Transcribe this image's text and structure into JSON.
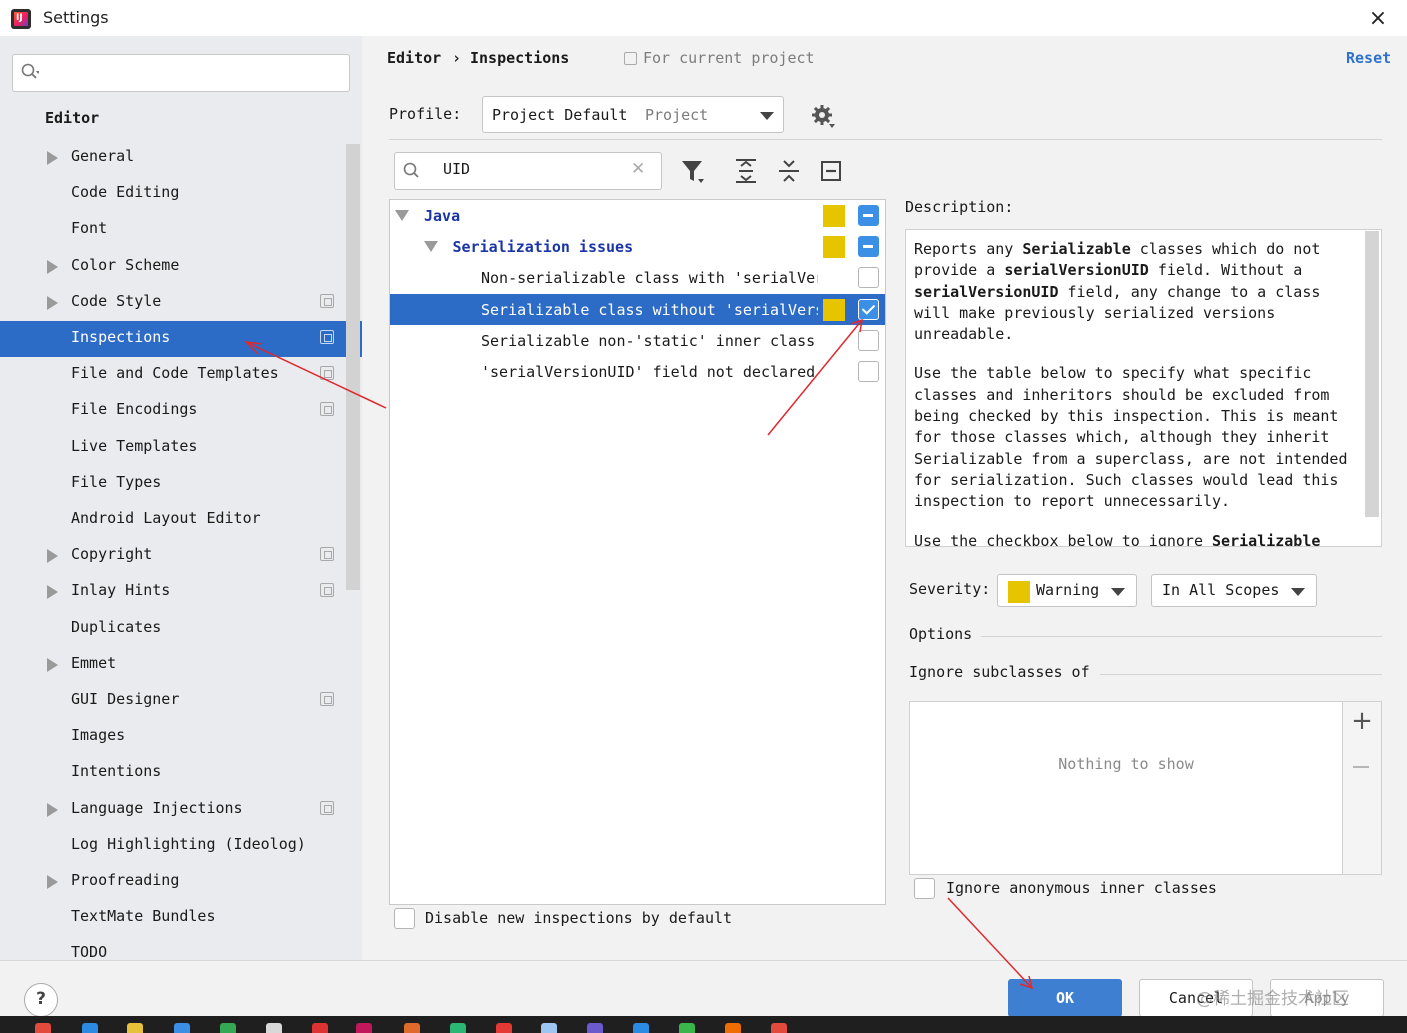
{
  "window": {
    "title": "Settings"
  },
  "sidebar": {
    "search": {
      "value": ""
    },
    "heading": "Editor",
    "items": [
      {
        "label": "General",
        "expandable": true,
        "project_icon": false
      },
      {
        "label": "Code Editing",
        "expandable": false,
        "project_icon": false
      },
      {
        "label": "Font",
        "expandable": false,
        "project_icon": false
      },
      {
        "label": "Color Scheme",
        "expandable": true,
        "project_icon": false
      },
      {
        "label": "Code Style",
        "expandable": true,
        "project_icon": true
      },
      {
        "label": "Inspections",
        "expandable": false,
        "project_icon": true,
        "selected": true
      },
      {
        "label": "File and Code Templates",
        "expandable": false,
        "project_icon": true
      },
      {
        "label": "File Encodings",
        "expandable": false,
        "project_icon": true
      },
      {
        "label": "Live Templates",
        "expandable": false,
        "project_icon": false
      },
      {
        "label": "File Types",
        "expandable": false,
        "project_icon": false
      },
      {
        "label": "Android Layout Editor",
        "expandable": false,
        "project_icon": false
      },
      {
        "label": "Copyright",
        "expandable": true,
        "project_icon": true
      },
      {
        "label": "Inlay Hints",
        "expandable": true,
        "project_icon": true
      },
      {
        "label": "Duplicates",
        "expandable": false,
        "project_icon": false
      },
      {
        "label": "Emmet",
        "expandable": true,
        "project_icon": false
      },
      {
        "label": "GUI Designer",
        "expandable": false,
        "project_icon": true
      },
      {
        "label": "Images",
        "expandable": false,
        "project_icon": false
      },
      {
        "label": "Intentions",
        "expandable": false,
        "project_icon": false
      },
      {
        "label": "Language Injections",
        "expandable": true,
        "project_icon": true
      },
      {
        "label": "Log Highlighting (Ideolog)",
        "expandable": false,
        "project_icon": false
      },
      {
        "label": "Proofreading",
        "expandable": true,
        "project_icon": false
      },
      {
        "label": "TextMate Bundles",
        "expandable": false,
        "project_icon": false
      },
      {
        "label": "TODO",
        "expandable": false,
        "project_icon": false
      }
    ]
  },
  "breadcrumb": {
    "parent": "Editor",
    "separator": "›",
    "current": "Inspections",
    "scope_note": "For current project"
  },
  "reset_label": "Reset",
  "profile": {
    "label": "Profile:",
    "value": "Project Default",
    "scope": "Project"
  },
  "filter": {
    "value": "UID"
  },
  "inspection_tree": [
    {
      "label": "Java",
      "level": 0,
      "group": true,
      "expanded": true,
      "severity_color": "#e6c400",
      "state": "mixed"
    },
    {
      "label": "Serialization issues",
      "level": 1,
      "group": true,
      "expanded": true,
      "severity_color": "#e6c400",
      "state": "mixed"
    },
    {
      "label": "Non-serializable class with 'serialVer",
      "level": 2,
      "group": false,
      "severity_color": "",
      "state": "unchecked"
    },
    {
      "label": "Serializable class without 'serialVers",
      "level": 2,
      "group": false,
      "severity_color": "#e6c400",
      "state": "checked",
      "selected": true
    },
    {
      "label": "Serializable non-'static' inner class",
      "level": 2,
      "group": false,
      "severity_color": "",
      "state": "unchecked"
    },
    {
      "label": "'serialVersionUID' field not declared",
      "level": 2,
      "group": false,
      "severity_color": "",
      "state": "unchecked"
    }
  ],
  "disable_new": {
    "label": "Disable new inspections by default",
    "checked": false
  },
  "description": {
    "label": "Description:",
    "p1": [
      {
        "t": "Reports any ",
        "b": false
      },
      {
        "t": "Serializable",
        "b": true
      },
      {
        "t": " classes which do not provide a ",
        "b": false
      },
      {
        "t": "serialVersionUID",
        "b": true
      },
      {
        "t": " field. Without a ",
        "b": false
      },
      {
        "t": "serialVersionUID",
        "b": true
      },
      {
        "t": " field, any change to a class will make previously serialized versions unreadable.",
        "b": false
      }
    ],
    "p2": [
      {
        "t": "Use the table below to specify what specific classes and inheritors should be excluded from being checked by this inspection. This is meant for those classes which, although they inherit Serializable from a superclass, are not intended for serialization. Such classes would lead this inspection to report unnecessarily.",
        "b": false
      }
    ],
    "p3": [
      {
        "t": "Use the checkbox below to ignore ",
        "b": false
      },
      {
        "t": "Serializable",
        "b": true
      }
    ]
  },
  "severity": {
    "label": "Severity:",
    "value": "Warning",
    "color": "#e6c400"
  },
  "scope_select": {
    "value": "In All Scopes"
  },
  "options": {
    "label": "Options",
    "ignore_label": "Ignore subclasses of",
    "empty_text": "Nothing to show",
    "anonymous": {
      "label": "Ignore anonymous inner classes",
      "checked": false
    }
  },
  "footer": {
    "help_label": "?",
    "ok_label": "OK",
    "cancel_label": "Cancel",
    "apply_label": "Apply",
    "watermark": "@稀土掘金技术社区"
  },
  "colors": {
    "accent": "#2d6cc6",
    "link": "#2e73c9",
    "severity_warning": "#e6c400",
    "annotation": "#e0282e"
  }
}
